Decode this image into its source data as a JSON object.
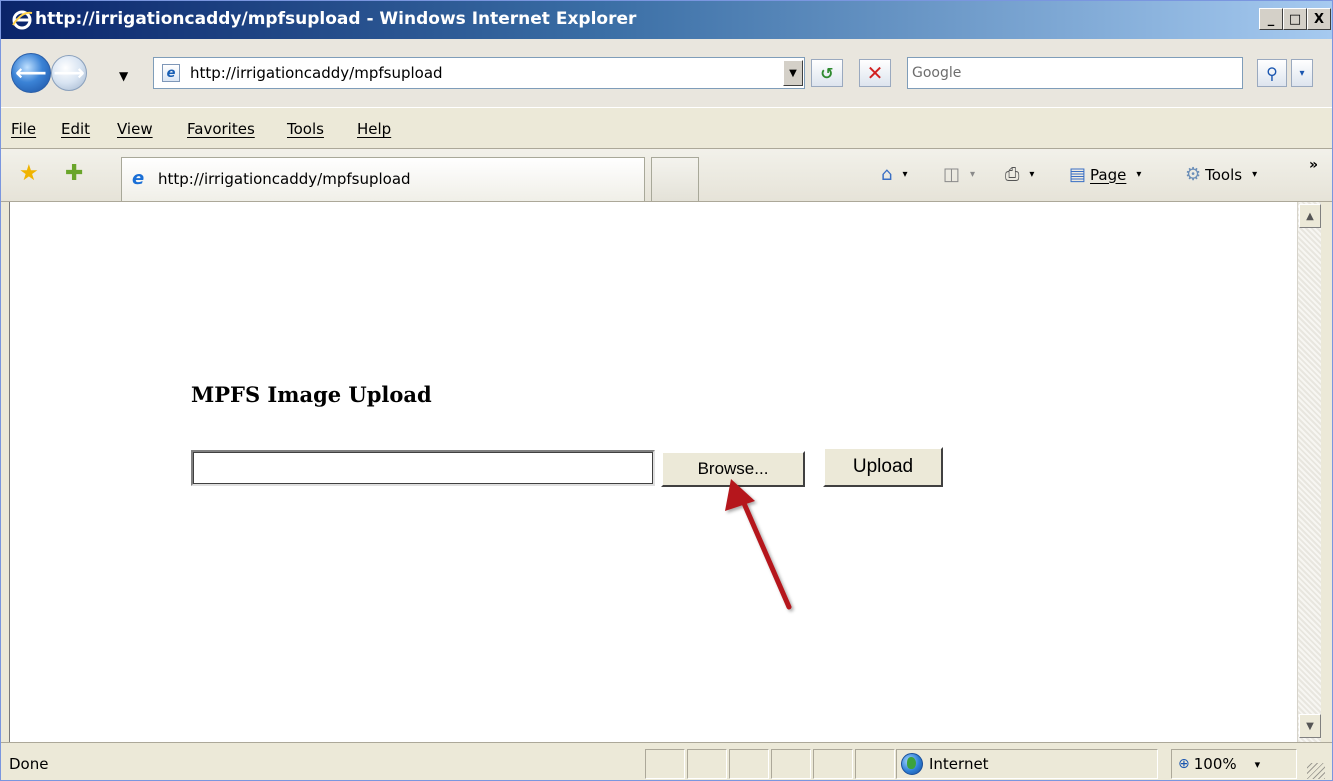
{
  "window": {
    "title": "http://irrigationcaddy/mpfsupload - Windows Internet Explorer",
    "minimize": "_",
    "maximize": "□",
    "close": "X"
  },
  "address": {
    "url": "http://irrigationcaddy/mpfsupload",
    "page_icon": "e",
    "dropdown_glyph": "▼",
    "refresh_glyph": "↺",
    "stop_glyph": "✕"
  },
  "search": {
    "placeholder": "Google",
    "go_glyph": "⚲",
    "dropdown_glyph": "▾"
  },
  "menu": {
    "items": [
      "File",
      "Edit",
      "View",
      "Favorites",
      "Tools",
      "Help"
    ]
  },
  "tab": {
    "title": "http://irrigationcaddy/mpfsupload",
    "icon": "e"
  },
  "command_bar": {
    "home_glyph": "⌂",
    "feeds_glyph": "◫",
    "print_glyph": "⎙",
    "page_label": "Page",
    "page_glyph": "▤",
    "tools_label": "Tools",
    "tools_glyph": "⚙",
    "caret": "▾",
    "overflow": "»"
  },
  "page": {
    "heading": "MPFS Image Upload",
    "file_value": "",
    "browse_label": "Browse...",
    "upload_label": "Upload"
  },
  "status": {
    "text": "Done",
    "zone": "Internet",
    "zoom": "100%",
    "zoom_glyph": "⊕",
    "zoom_caret": "▾"
  },
  "scroll": {
    "up": "▲",
    "down": "▼"
  },
  "colors": {
    "annotation_arrow": "#b5161b",
    "titlebar_start": "#0a246a",
    "titlebar_end": "#a6caf0"
  }
}
